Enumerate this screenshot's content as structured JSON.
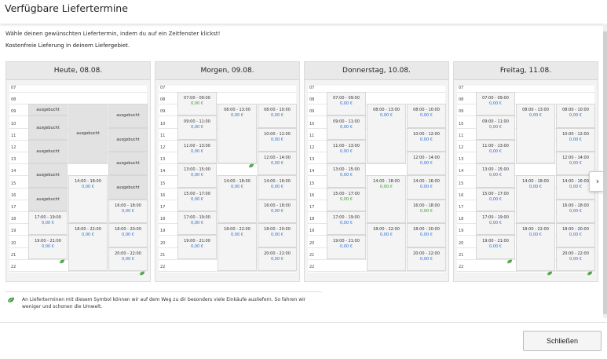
{
  "dialog": {
    "title": "Verfügbare Liefertermine",
    "intro": "Wähle deinen gewünschten Liefertermin, indem du auf ein Zeitfenster klickst!",
    "subtitle": "Kostenfreie Lieferung in deinem Liefergebiet.",
    "legend_text": "An Lieferterminen mit diesem Symbol können wir auf dem Weg zu dir besonders viele Einkäufe ausliefern. So fahren wir weniger und schonen die Umwelt.",
    "close_label": "Schließen",
    "next_arrow": "›",
    "colors": {
      "price": "#2a6fd0",
      "eco": "#3a9a3a",
      "booked": "#e2e2e2",
      "slot": "#f4f4f4"
    }
  },
  "hours": [
    "07",
    "08",
    "09",
    "10",
    "11",
    "12",
    "13",
    "14",
    "15",
    "16",
    "17",
    "18",
    "19",
    "20",
    "21",
    "22"
  ],
  "days": [
    {
      "label": "Heute, 08.08.",
      "slots": [
        {
          "col": 0,
          "start": 8,
          "end": 9,
          "booked": true,
          "text": "ausgebucht"
        },
        {
          "col": 0,
          "start": 9,
          "end": 11,
          "booked": true,
          "text": "ausgebucht"
        },
        {
          "col": 0,
          "start": 11,
          "end": 13,
          "booked": true,
          "text": "ausgebucht"
        },
        {
          "col": 0,
          "start": 13,
          "end": 15,
          "booked": true,
          "text": "ausgebucht"
        },
        {
          "col": 0,
          "start": 15,
          "end": 17,
          "booked": true,
          "text": "ausgebucht"
        },
        {
          "col": 0,
          "start": 17,
          "end": 19,
          "booked": false,
          "time": "17:00 - 19:00",
          "price": "0,00 €",
          "eco": false
        },
        {
          "col": 0,
          "start": 19,
          "end": 21,
          "booked": false,
          "time": "19:00 - 21:00",
          "price": "0,00 €",
          "eco": true
        },
        {
          "col": 1,
          "start": 8,
          "end": 13,
          "booked": true,
          "text": "ausgebucht"
        },
        {
          "col": 1,
          "start": 14,
          "end": 18,
          "booked": false,
          "time": "14:00 - 18:00",
          "price": "0,00 €",
          "eco": false
        },
        {
          "col": 1,
          "start": 18,
          "end": 22,
          "booked": false,
          "time": "18:00 - 22:00",
          "price": "0,00 €",
          "eco": false
        },
        {
          "col": 2,
          "start": 8,
          "end": 10,
          "booked": true,
          "text": "ausgebucht"
        },
        {
          "col": 2,
          "start": 10,
          "end": 12,
          "booked": true,
          "text": "ausgebucht"
        },
        {
          "col": 2,
          "start": 12,
          "end": 14,
          "booked": true,
          "text": "ausgebucht"
        },
        {
          "col": 2,
          "start": 14,
          "end": 16,
          "booked": true,
          "text": "ausgebucht"
        },
        {
          "col": 2,
          "start": 16,
          "end": 18,
          "booked": false,
          "time": "16:00 - 18:00",
          "price": "0,00 €",
          "eco": false
        },
        {
          "col": 2,
          "start": 18,
          "end": 20,
          "booked": false,
          "time": "18:00 - 20:00",
          "price": "0,00 €",
          "eco": true
        },
        {
          "col": 2,
          "start": 20,
          "end": 22,
          "booked": false,
          "time": "20:00 - 22:00",
          "price": "0,00 €",
          "eco": true
        }
      ]
    },
    {
      "label": "Morgen, 09.08.",
      "slots": [
        {
          "col": 0,
          "start": 7,
          "end": 9,
          "booked": false,
          "time": "07:00 - 09:00",
          "price": "0,00 €",
          "green": true,
          "eco": true
        },
        {
          "col": 0,
          "start": 9,
          "end": 11,
          "booked": false,
          "time": "09:00 - 11:00",
          "price": "0,00 €",
          "eco": false
        },
        {
          "col": 0,
          "start": 11,
          "end": 13,
          "booked": false,
          "time": "11:00 - 13:00",
          "price": "0,00 €",
          "eco": false
        },
        {
          "col": 0,
          "start": 13,
          "end": 15,
          "booked": false,
          "time": "13:00 - 15:00",
          "price": "0,00 €",
          "eco": false
        },
        {
          "col": 0,
          "start": 15,
          "end": 17,
          "booked": false,
          "time": "15:00 - 17:00",
          "price": "0,00 €",
          "eco": false
        },
        {
          "col": 0,
          "start": 17,
          "end": 19,
          "booked": false,
          "time": "17:00 - 19:00",
          "price": "0,00 €",
          "eco": false
        },
        {
          "col": 0,
          "start": 19,
          "end": 21,
          "booked": false,
          "time": "19:00 - 21:00",
          "price": "0,00 €",
          "eco": false
        },
        {
          "col": 1,
          "start": 8,
          "end": 13,
          "booked": false,
          "time": "08:00 - 13:00",
          "price": "0,00 €",
          "eco": true
        },
        {
          "col": 1,
          "start": 14,
          "end": 18,
          "booked": false,
          "time": "14:00 - 18:00",
          "price": "0,00 €",
          "eco": false
        },
        {
          "col": 1,
          "start": 18,
          "end": 22,
          "booked": false,
          "time": "18:00 - 22:00",
          "price": "0,00 €",
          "eco": false
        },
        {
          "col": 2,
          "start": 8,
          "end": 10,
          "booked": false,
          "time": "08:00 - 10:00",
          "price": "0,00 €",
          "eco": true
        },
        {
          "col": 2,
          "start": 10,
          "end": 12,
          "booked": false,
          "time": "10:00 - 12:00",
          "price": "0,00 €",
          "eco": false
        },
        {
          "col": 2,
          "start": 12,
          "end": 14,
          "booked": false,
          "time": "12:00 - 14:00",
          "price": "0,00 €",
          "eco": false
        },
        {
          "col": 2,
          "start": 14,
          "end": 16,
          "booked": false,
          "time": "14:00 - 16:00",
          "price": "0,00 €",
          "eco": false
        },
        {
          "col": 2,
          "start": 16,
          "end": 18,
          "booked": false,
          "time": "16:00 - 18:00",
          "price": "0,00 €",
          "eco": false
        },
        {
          "col": 2,
          "start": 18,
          "end": 20,
          "booked": false,
          "time": "18:00 - 20:00",
          "price": "0,00 €",
          "eco": false
        },
        {
          "col": 2,
          "start": 20,
          "end": 22,
          "booked": false,
          "time": "20:00 - 22:00",
          "price": "0,00 €",
          "eco": false
        }
      ]
    },
    {
      "label": "Donnerstag, 10.08.",
      "slots": [
        {
          "col": 0,
          "start": 7,
          "end": 9,
          "booked": false,
          "time": "07:00 - 09:00",
          "price": "0,00 €",
          "eco": false
        },
        {
          "col": 0,
          "start": 9,
          "end": 11,
          "booked": false,
          "time": "09:00 - 11:00",
          "price": "0,00 €",
          "eco": false
        },
        {
          "col": 0,
          "start": 11,
          "end": 13,
          "booked": false,
          "time": "11:00 - 13:00",
          "price": "0,00 €",
          "eco": false
        },
        {
          "col": 0,
          "start": 13,
          "end": 15,
          "booked": false,
          "time": "13:00 - 15:00",
          "price": "0,00 €",
          "eco": false
        },
        {
          "col": 0,
          "start": 15,
          "end": 17,
          "booked": false,
          "time": "15:00 - 17:00",
          "price": "0,00 €",
          "green": true,
          "eco": true
        },
        {
          "col": 0,
          "start": 17,
          "end": 19,
          "booked": false,
          "time": "17:00 - 19:00",
          "price": "0,00 €",
          "eco": false
        },
        {
          "col": 0,
          "start": 19,
          "end": 21,
          "booked": false,
          "time": "19:00 - 21:00",
          "price": "0,00 €",
          "eco": false
        },
        {
          "col": 1,
          "start": 8,
          "end": 13,
          "booked": false,
          "time": "08:00 - 13:00",
          "price": "0,00 €",
          "eco": false
        },
        {
          "col": 1,
          "start": 14,
          "end": 18,
          "booked": false,
          "time": "14:00 - 18:00",
          "price": "0,00 €",
          "green": true,
          "eco": true
        },
        {
          "col": 1,
          "start": 18,
          "end": 22,
          "booked": false,
          "time": "18:00 - 22:00",
          "price": "0,00 €",
          "eco": false
        },
        {
          "col": 2,
          "start": 8,
          "end": 10,
          "booked": false,
          "time": "08:00 - 10:00",
          "price": "0,00 €",
          "eco": false
        },
        {
          "col": 2,
          "start": 10,
          "end": 12,
          "booked": false,
          "time": "10:00 - 12:00",
          "price": "0,00 €",
          "eco": false
        },
        {
          "col": 2,
          "start": 12,
          "end": 14,
          "booked": false,
          "time": "12:00 - 14:00",
          "price": "0,00 €",
          "eco": false
        },
        {
          "col": 2,
          "start": 14,
          "end": 16,
          "booked": false,
          "time": "14:00 - 16:00",
          "price": "0,00 €",
          "eco": false
        },
        {
          "col": 2,
          "start": 16,
          "end": 18,
          "booked": false,
          "time": "16:00 - 18:00",
          "price": "0,00 €",
          "green": true,
          "eco": true
        },
        {
          "col": 2,
          "start": 18,
          "end": 20,
          "booked": false,
          "time": "18:00 - 20:00",
          "price": "0,00 €",
          "eco": false
        },
        {
          "col": 2,
          "start": 20,
          "end": 22,
          "booked": false,
          "time": "20:00 - 22:00",
          "price": "0,00 €",
          "eco": false
        }
      ]
    },
    {
      "label": "Freitag, 11.08.",
      "slots": [
        {
          "col": 0,
          "start": 7,
          "end": 9,
          "booked": false,
          "time": "07:00 - 09:00",
          "price": "0,00 €",
          "eco": false
        },
        {
          "col": 0,
          "start": 9,
          "end": 11,
          "booked": false,
          "time": "09:00 - 11:00",
          "price": "0,00 €",
          "eco": false
        },
        {
          "col": 0,
          "start": 11,
          "end": 13,
          "booked": false,
          "time": "11:00 - 13:00",
          "price": "0,00 €",
          "eco": false
        },
        {
          "col": 0,
          "start": 13,
          "end": 15,
          "booked": false,
          "time": "13:00 - 15:00",
          "price": "0,00 €",
          "eco": false
        },
        {
          "col": 0,
          "start": 15,
          "end": 17,
          "booked": false,
          "time": "15:00 - 17:00",
          "price": "0,00 €",
          "eco": false
        },
        {
          "col": 0,
          "start": 17,
          "end": 19,
          "booked": false,
          "time": "17:00 - 19:00",
          "price": "0,00 €",
          "eco": false
        },
        {
          "col": 0,
          "start": 19,
          "end": 21,
          "booked": false,
          "time": "19:00 - 21:00",
          "price": "0,00 €",
          "eco": true
        },
        {
          "col": 1,
          "start": 8,
          "end": 13,
          "booked": false,
          "time": "08:00 - 13:00",
          "price": "0,00 €",
          "eco": false
        },
        {
          "col": 1,
          "start": 14,
          "end": 18,
          "booked": false,
          "time": "14:00 - 18:00",
          "price": "0,00 €",
          "eco": false
        },
        {
          "col": 1,
          "start": 18,
          "end": 22,
          "booked": false,
          "time": "18:00 - 22:00",
          "price": "0,00 €",
          "eco": true
        },
        {
          "col": 2,
          "start": 8,
          "end": 10,
          "booked": false,
          "time": "08:00 - 10:00",
          "price": "0,00 €",
          "eco": false
        },
        {
          "col": 2,
          "start": 10,
          "end": 12,
          "booked": false,
          "time": "10:00 - 12:00",
          "price": "0,00 €",
          "eco": false
        },
        {
          "col": 2,
          "start": 12,
          "end": 14,
          "booked": false,
          "time": "12:00 - 14:00",
          "price": "0,00 €",
          "eco": false
        },
        {
          "col": 2,
          "start": 14,
          "end": 16,
          "booked": false,
          "time": "14:00 - 16:00",
          "price": "0,00 €",
          "eco": false
        },
        {
          "col": 2,
          "start": 16,
          "end": 18,
          "booked": false,
          "time": "16:00 - 18:00",
          "price": "0,00 €",
          "eco": false
        },
        {
          "col": 2,
          "start": 18,
          "end": 20,
          "booked": false,
          "time": "18:00 - 20:00",
          "price": "0,00 €",
          "eco": true
        },
        {
          "col": 2,
          "start": 20,
          "end": 22,
          "booked": false,
          "time": "20:00 - 22:00",
          "price": "0,00 €",
          "eco": true
        }
      ]
    }
  ]
}
